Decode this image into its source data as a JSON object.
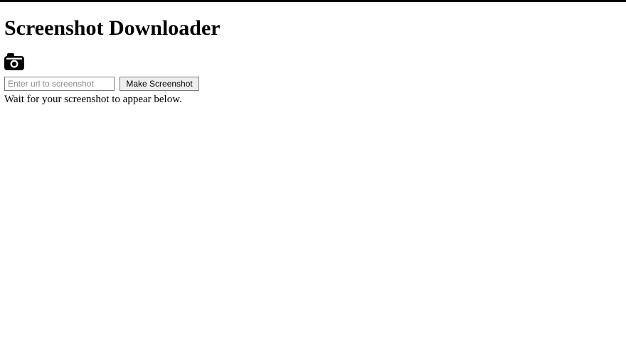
{
  "header": {
    "title": "Screenshot Downloader"
  },
  "form": {
    "url_placeholder": "Enter url to screenshot",
    "url_value": "",
    "button_label": "Make Screenshot"
  },
  "status": {
    "text": "Wait for your screenshot to appear below."
  },
  "icons": {
    "camera": "camera-icon"
  }
}
